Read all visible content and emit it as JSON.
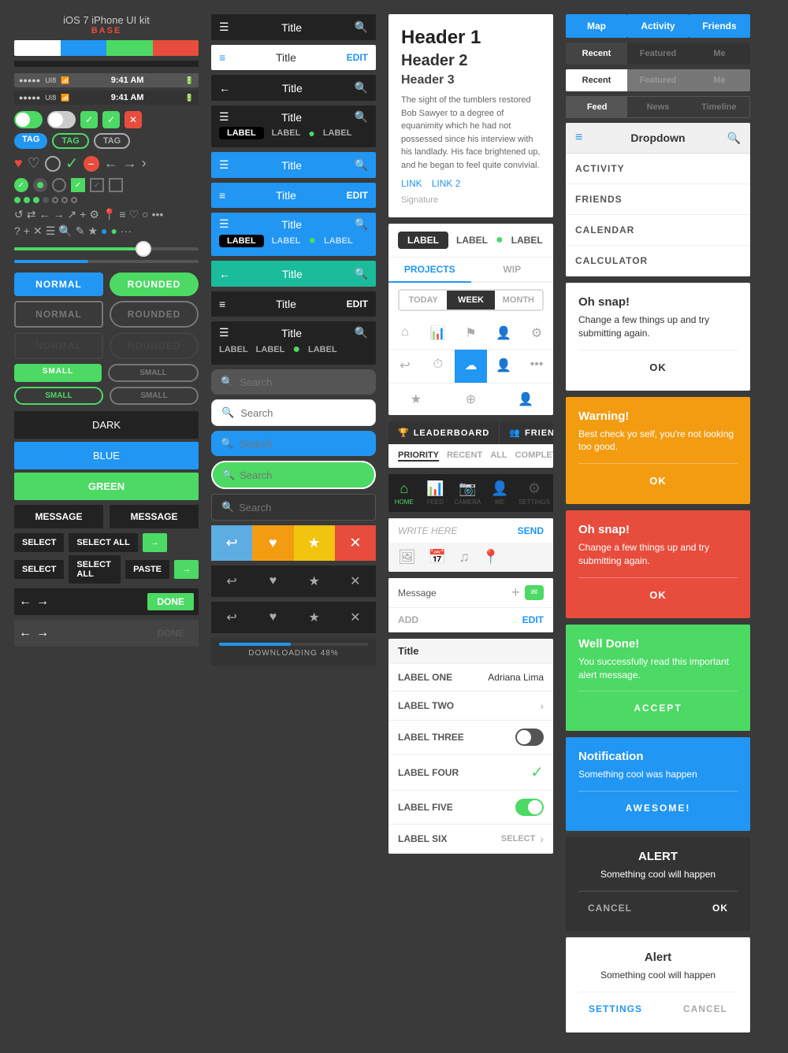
{
  "kit": {
    "title": "iOS 7 iPhone UI kit",
    "base": "BASE"
  },
  "colors": {
    "white": "#FFFFFF",
    "blue": "#2196F3",
    "green": "#4cd964",
    "red": "#e74c3c",
    "black": "#222222",
    "orange": "#f39c12",
    "yellow": "#f1c40f"
  },
  "col1": {
    "toggles": [
      "on",
      "on",
      "off"
    ],
    "tags": [
      "TAG",
      "TAG",
      "TAG"
    ],
    "buttons": {
      "normal": "NORMAL",
      "rounded": "ROUNDED",
      "dark": "DARK",
      "blue": "BLUE",
      "green": "GREEN",
      "message": "MESSAGE",
      "select": "SELECT",
      "select_all": "SELECT ALL",
      "paste": "PASTE",
      "small": "SMALL",
      "done": "DONE"
    },
    "progress": 70
  },
  "col2": {
    "navbars": [
      {
        "title": "Title",
        "leftIcon": "☰",
        "rightIcon": "🔍",
        "theme": "dark"
      },
      {
        "title": "Title",
        "leftIcon": "≡",
        "rightIcon": "EDIT",
        "theme": "white"
      },
      {
        "title": "Title",
        "leftIcon": "←",
        "rightIcon": "🔍",
        "theme": "dark"
      },
      {
        "title": "Title",
        "leftIcon": "☰",
        "rightIcon": "🔍",
        "labels": [
          "LABEL",
          "LABEL",
          "LABEL"
        ],
        "theme": "dark"
      },
      {
        "title": "Title",
        "leftIcon": "☰",
        "rightIcon": "🔍",
        "theme": "blue"
      },
      {
        "title": "Title",
        "leftIcon": "≡",
        "rightIcon": "EDIT",
        "theme": "blue"
      },
      {
        "title": "Title",
        "leftIcon": "☰",
        "rightIcon": "🔍",
        "labels": [
          "LABEL",
          "LABEL",
          "LABEL"
        ],
        "theme": "blue"
      },
      {
        "title": "Title",
        "leftIcon": "←",
        "rightIcon": "🔍",
        "theme": "teal"
      },
      {
        "title": "Title",
        "leftIcon": "≡",
        "rightIcon": "EDIT",
        "theme": "teal"
      },
      {
        "title": "Title",
        "leftIcon": "☰",
        "rightIcon": "🔍",
        "labels": [
          "LABEL",
          "LABEL",
          "LABEL"
        ],
        "theme": "dark"
      }
    ],
    "searchBars": [
      {
        "placeholder": "Search",
        "theme": "dark-bg"
      },
      {
        "placeholder": "Search",
        "theme": "white"
      },
      {
        "placeholder": "Search",
        "theme": "blue"
      },
      {
        "placeholder": "Search",
        "theme": "green"
      },
      {
        "placeholder": "Search",
        "theme": "dark-border"
      }
    ],
    "actionButtons": [
      {
        "icon": "↩",
        "color": "blue-light"
      },
      {
        "icon": "♥",
        "color": "orange"
      },
      {
        "icon": "★",
        "color": "yellow"
      },
      {
        "icon": "✕",
        "color": "red"
      }
    ],
    "progressLabel": "DOWNLOADING 48%",
    "progressValue": 48
  },
  "col3": {
    "article": {
      "h1": "Header 1",
      "h2": "Header 2",
      "h3": "Header 3",
      "body": "The sight of the tumblers restored Bob Sawyer to a degree of equanimity which he had not possessed since his interview with his landlady. His face brightened up, and he began to feel quite convivial.",
      "link1": "LINK",
      "link2": "LINK 2",
      "signature": "Signature"
    },
    "tabs": [
      "PROJECTS",
      "WIP"
    ],
    "segments": [
      "TODAY",
      "WEEK",
      "MONTH"
    ],
    "filter": [
      "PRIORITY",
      "RECENT",
      "ALL",
      "COMPLETE"
    ],
    "bottomNav": [
      {
        "icon": "⌂",
        "label": "HOME",
        "active": true
      },
      {
        "icon": "📊",
        "label": "FEED"
      },
      {
        "icon": "📷",
        "label": "CAMERA"
      },
      {
        "icon": "👤",
        "label": "ME"
      },
      {
        "icon": "⚙",
        "label": "SETTINGS"
      }
    ],
    "chatPlaceholder": "WRITE HERE",
    "chatSend": "SEND",
    "messageLabel": "Message",
    "addLabel": "ADD",
    "editLabel": "EDIT",
    "tableTitle": "Title",
    "tableRows": [
      {
        "label": "LABEL ONE",
        "value": "Adriana Lima",
        "type": "text"
      },
      {
        "label": "LABEL TWO",
        "value": "",
        "type": "arrow"
      },
      {
        "label": "LABEL THREE",
        "value": "",
        "type": "toggle-off"
      },
      {
        "label": "LABEL FOUR",
        "value": "",
        "type": "check"
      },
      {
        "label": "LABEL FIVE",
        "value": "",
        "type": "toggle-on"
      },
      {
        "label": "LABEL SIX",
        "value": "SELECT",
        "type": "select-arrow"
      }
    ]
  },
  "col4": {
    "topTabs": [
      "Map",
      "Activity",
      "Friends"
    ],
    "tabRows": [
      {
        "items": [
          "Recent",
          "Featured",
          "Me"
        ],
        "active": 0
      },
      {
        "items": [
          "Recent",
          "Featured",
          "Me"
        ],
        "active": 0
      },
      {
        "items": [
          "Feed",
          "News",
          "Timeline"
        ],
        "active": 0
      }
    ],
    "dropdown": {
      "title": "Dropdown",
      "items": [
        "ACTIVITY",
        "FRIENDS",
        "CALENDAR",
        "CALCULATOR"
      ]
    },
    "alerts": [
      {
        "type": "white",
        "title": "Oh snap!",
        "body": "Change a few things up and try submitting again.",
        "buttons": [
          "OK"
        ],
        "titleAlign": "left"
      },
      {
        "type": "orange",
        "title": "Warning!",
        "body": "Best check yo self, you're not looking too good.",
        "buttons": [
          "OK"
        ],
        "titleAlign": "left"
      },
      {
        "type": "red",
        "title": "Oh snap!",
        "body": "Change a few things up and try submitting again.",
        "buttons": [
          "OK"
        ],
        "titleAlign": "left"
      },
      {
        "type": "green",
        "title": "Well Done!",
        "body": "You successfully read this important alert message.",
        "buttons": [
          "ACCEPT"
        ],
        "titleAlign": "left"
      },
      {
        "type": "blue",
        "title": "Notification",
        "body": "Something cool was happen",
        "buttons": [
          "AWESOME!"
        ],
        "titleAlign": "left"
      },
      {
        "type": "dark",
        "title": "ALERT",
        "body": "Something cool will happen",
        "buttons": [
          "CANCEL",
          "OK"
        ],
        "titleAlign": "center"
      },
      {
        "type": "light",
        "title": "Alert",
        "body": "Something cool will happen",
        "buttons": [
          "SETTINGS",
          "CANCEL"
        ],
        "titleAlign": "center"
      }
    ]
  }
}
